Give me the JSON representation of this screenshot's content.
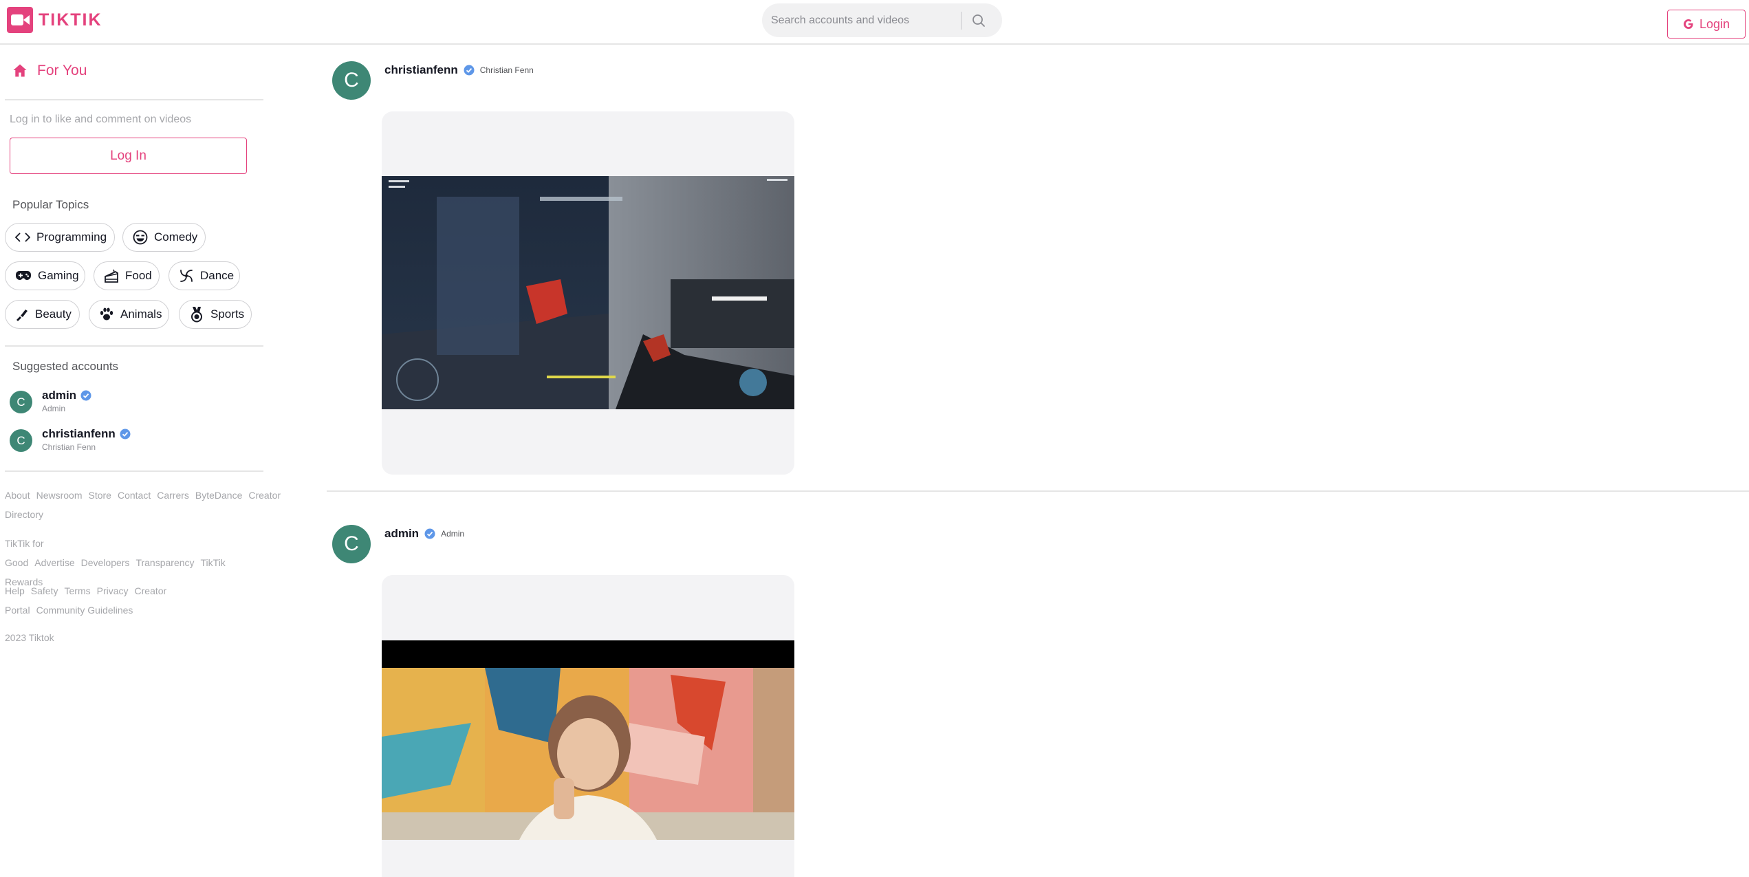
{
  "app": {
    "name": "TIKTIK",
    "accent": "#e4427d",
    "avatar_color": "#3e8775"
  },
  "navbar": {
    "search_placeholder": "Search accounts and videos",
    "login_label": "Login"
  },
  "sidebar": {
    "for_you_label": "For You",
    "login_hint": "Log in to like and comment on videos",
    "login_button": "Log In",
    "topics_title": "Popular Topics",
    "topics": [
      {
        "label": "Programming",
        "icon": "code-icon"
      },
      {
        "label": "Comedy",
        "icon": "laughing-face-icon"
      },
      {
        "label": "Gaming",
        "icon": "gamepad-icon"
      },
      {
        "label": "Food",
        "icon": "cake-icon"
      },
      {
        "label": "Dance",
        "icon": "dance-icon"
      },
      {
        "label": "Beauty",
        "icon": "lipstick-icon"
      },
      {
        "label": "Animals",
        "icon": "paw-icon"
      },
      {
        "label": "Sports",
        "icon": "medal-icon"
      }
    ],
    "suggested_title": "Suggested accounts",
    "accounts": [
      {
        "initial": "C",
        "username": "admin",
        "display": "Admin"
      },
      {
        "initial": "C",
        "username": "christianfenn",
        "display": "Christian Fenn"
      }
    ],
    "footer": {
      "row1": [
        "About",
        "Newsroom",
        "Store",
        "Contact",
        "Carrers",
        "ByteDance",
        "Creator Directory"
      ],
      "row2": [
        "TikTik for Good",
        "Advertise",
        "Developers",
        "Transparency",
        "TikTik Rewards"
      ],
      "row3": [
        "Help",
        "Safety",
        "Terms",
        "Privacy",
        "Creator Portal",
        "Community Guidelines"
      ],
      "copyright": "2023 Tiktok"
    }
  },
  "feed": {
    "posts": [
      {
        "initial": "C",
        "username": "christianfenn",
        "display": "Christian Fenn",
        "video": "sci-fi shooter gameplay"
      },
      {
        "initial": "C",
        "username": "admin",
        "display": "Admin",
        "video": "person in front of colorful mural"
      }
    ]
  }
}
